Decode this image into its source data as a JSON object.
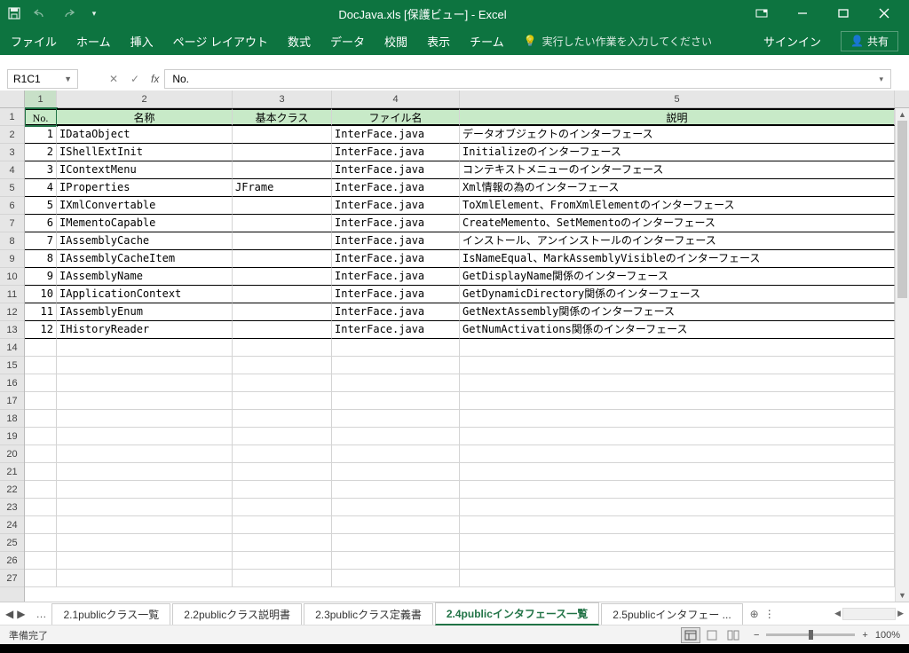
{
  "title": "DocJava.xls  [保護ビュー] - Excel",
  "ribbon": {
    "file": "ファイル",
    "home": "ホーム",
    "insert": "挿入",
    "pagelayout": "ページ レイアウト",
    "formulas": "数式",
    "data": "データ",
    "review": "校閲",
    "view": "表示",
    "team": "チーム",
    "tellme": "実行したい作業を入力してください",
    "signin": "サインイン",
    "share": "共有"
  },
  "namebox": "R1C1",
  "formula": "No.",
  "colHeaders": [
    "1",
    "2",
    "3",
    "4",
    "5"
  ],
  "headerRow": [
    "No.",
    "名称",
    "基本クラス",
    "ファイル名",
    "説明"
  ],
  "rows": [
    {
      "no": "1",
      "name": "IDataObject",
      "base": "",
      "file": "InterFace.java",
      "desc": "データオブジェクトのインターフェース"
    },
    {
      "no": "2",
      "name": "IShellExtInit",
      "base": "",
      "file": "InterFace.java",
      "desc": "Initializeのインターフェース"
    },
    {
      "no": "3",
      "name": "IContextMenu",
      "base": "",
      "file": "InterFace.java",
      "desc": "コンテキストメニューのインターフェース"
    },
    {
      "no": "4",
      "name": "IProperties",
      "base": "JFrame",
      "file": "InterFace.java",
      "desc": "Xml情報の為のインターフェース"
    },
    {
      "no": "5",
      "name": "IXmlConvertable",
      "base": "",
      "file": "InterFace.java",
      "desc": "ToXmlElement、FromXmlElementのインターフェース"
    },
    {
      "no": "6",
      "name": "IMementoCapable",
      "base": "",
      "file": "InterFace.java",
      "desc": "CreateMemento、SetMementoのインターフェース"
    },
    {
      "no": "7",
      "name": "IAssemblyCache",
      "base": "",
      "file": "InterFace.java",
      "desc": "インストール、アンインストールのインターフェース"
    },
    {
      "no": "8",
      "name": "IAssemblyCacheItem",
      "base": "",
      "file": "InterFace.java",
      "desc": "IsNameEqual、MarkAssemblyVisibleのインターフェース"
    },
    {
      "no": "9",
      "name": "IAssemblyName",
      "base": "",
      "file": "InterFace.java",
      "desc": "GetDisplayName関係のインターフェース"
    },
    {
      "no": "10",
      "name": "IApplicationContext",
      "base": "",
      "file": "InterFace.java",
      "desc": "GetDynamicDirectory関係のインターフェース"
    },
    {
      "no": "11",
      "name": "IAssemblyEnum",
      "base": "",
      "file": "InterFace.java",
      "desc": "GetNextAssembly関係のインターフェース"
    },
    {
      "no": "12",
      "name": "IHistoryReader",
      "base": "",
      "file": "InterFace.java",
      "desc": "GetNumActivations関係のインターフェース"
    }
  ],
  "emptyRows": 14,
  "sheets": {
    "s1": "2.1publicクラス一覧",
    "s2": "2.2publicクラス説明書",
    "s3": "2.3publicクラス定義書",
    "s4": "2.4publicインタフェース一覧",
    "s5": "2.5publicインタフェー ..."
  },
  "status": "準備完了",
  "zoom": "100%"
}
